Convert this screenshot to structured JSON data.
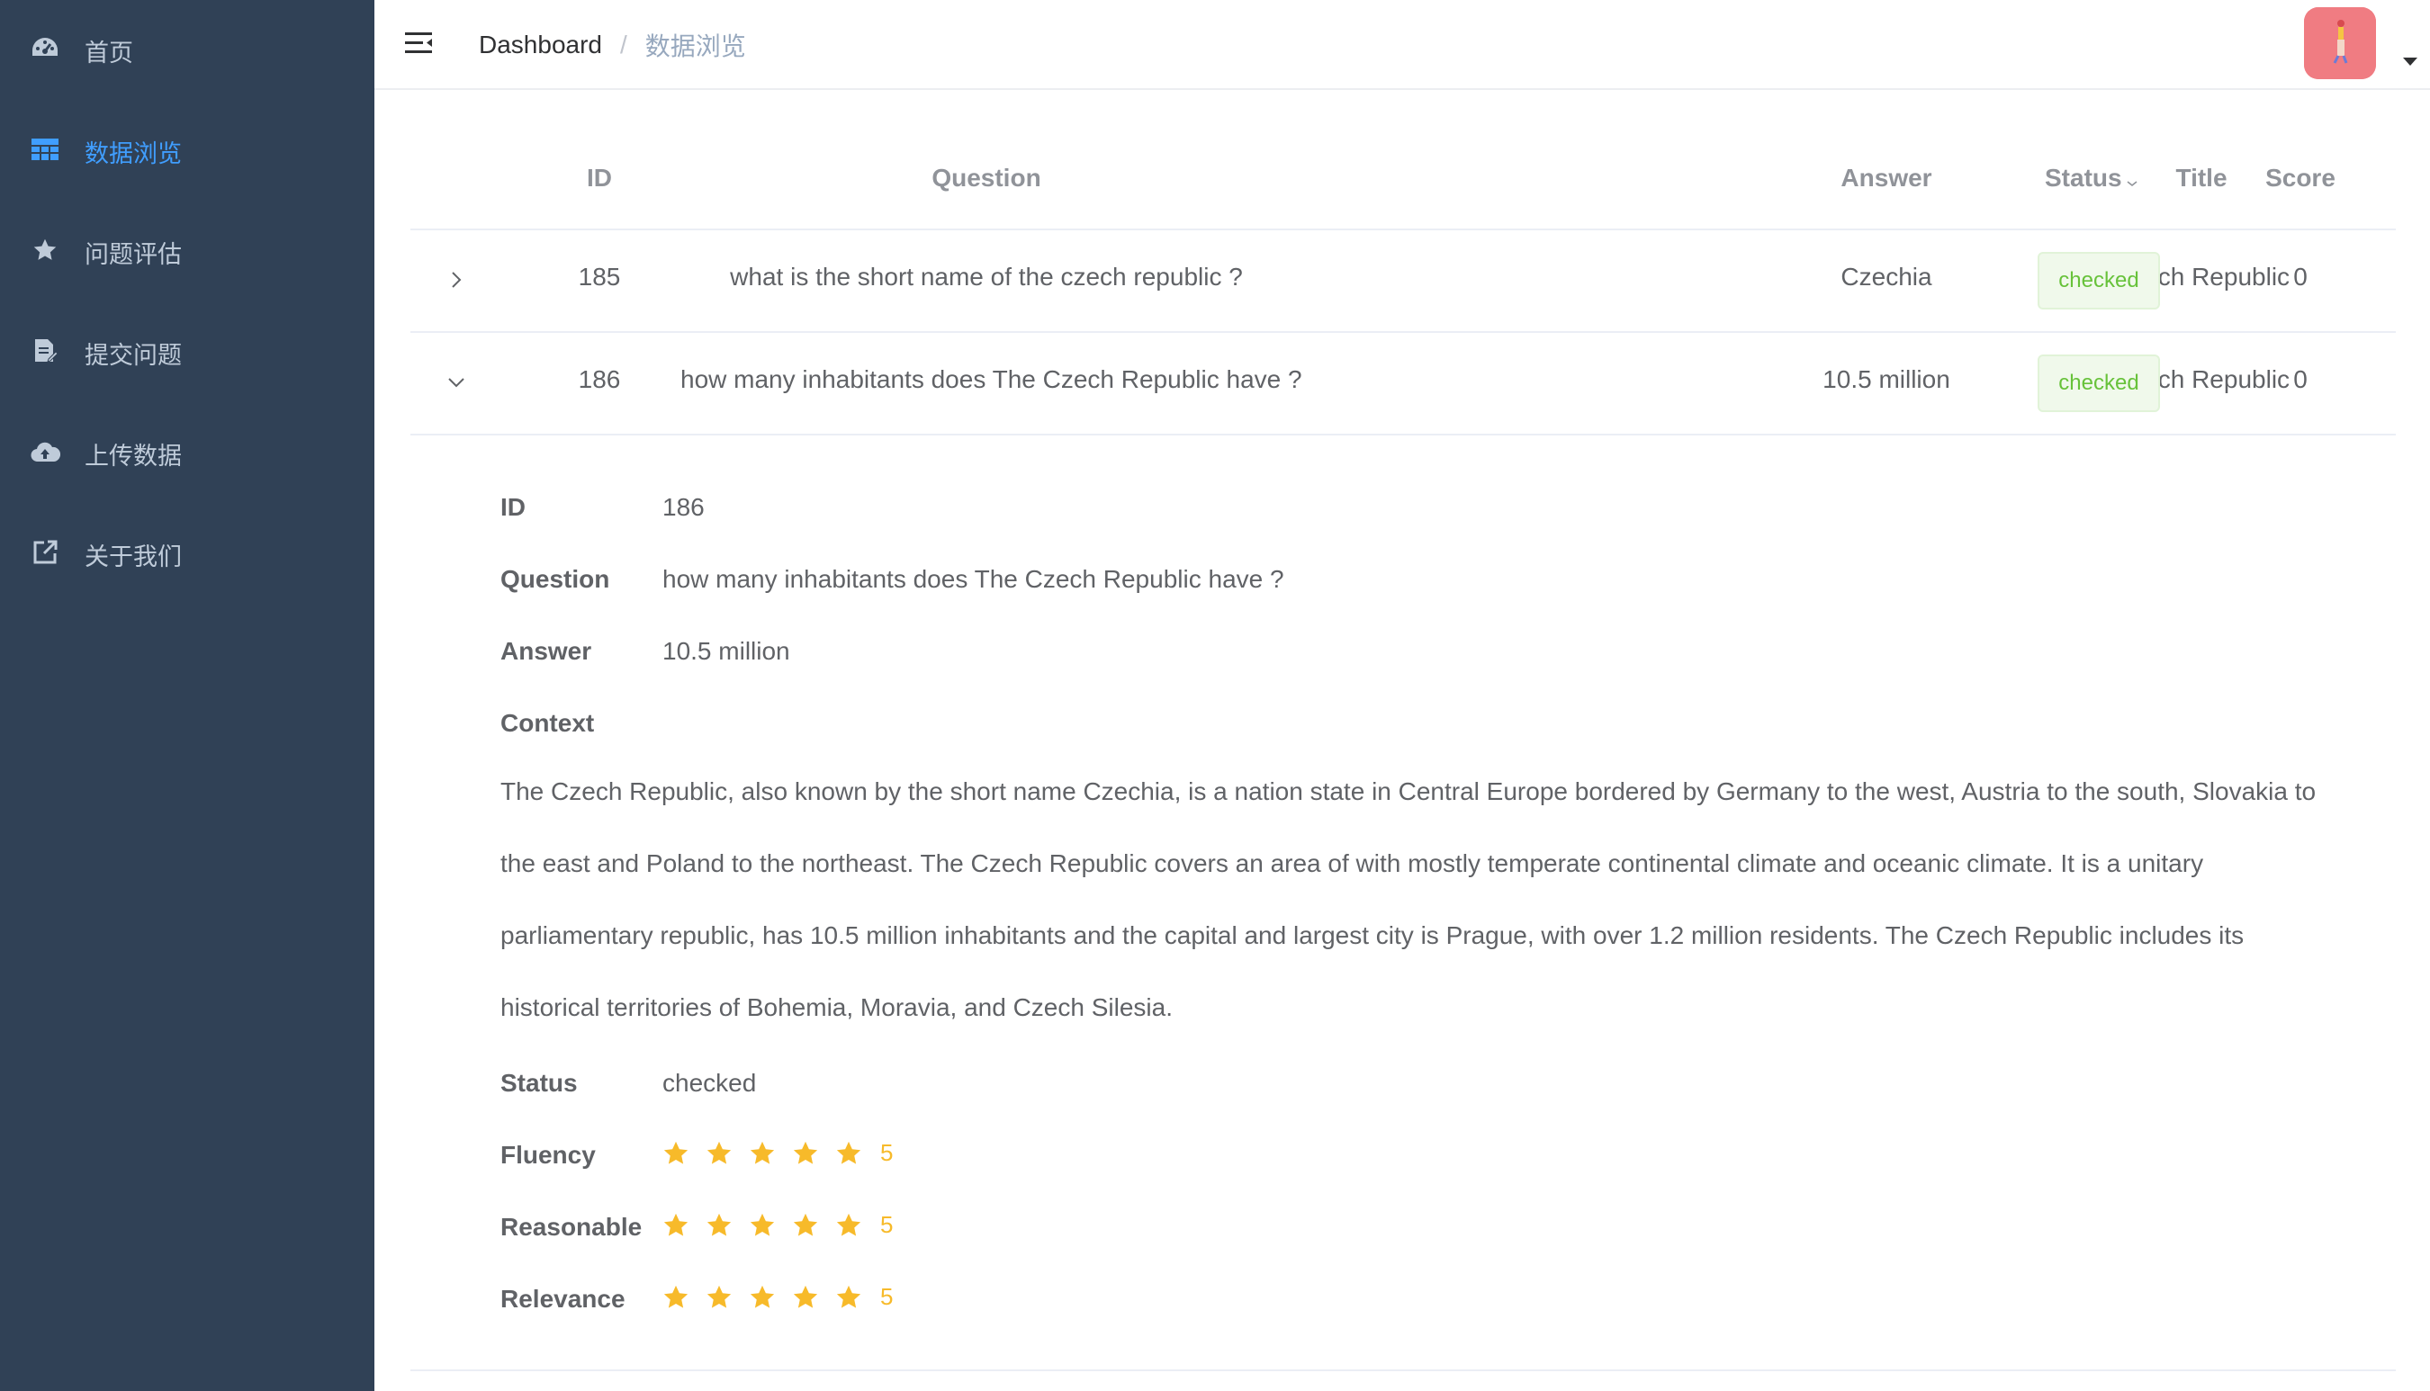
{
  "sidebar": {
    "items": [
      {
        "label": "首页",
        "icon": "dashboard-icon"
      },
      {
        "label": "数据浏览",
        "icon": "table-icon",
        "active": true
      },
      {
        "label": "问题评估",
        "icon": "star-icon"
      },
      {
        "label": "提交问题",
        "icon": "edit-doc-icon"
      },
      {
        "label": "上传数据",
        "icon": "cloud-upload-icon"
      },
      {
        "label": "关于我们",
        "icon": "external-link-icon"
      }
    ]
  },
  "navbar": {
    "breadcrumb": {
      "home": "Dashboard",
      "separator": "/",
      "current": "数据浏览"
    }
  },
  "table": {
    "headers": {
      "id": "ID",
      "question": "Question",
      "answer": "Answer",
      "title": "Title",
      "status": "Status",
      "score": "Score"
    },
    "rows": [
      {
        "id": "185",
        "question": "what is the short name of the czech republic ?",
        "answer": "Czechia",
        "title": "Czech Republic",
        "status": "checked",
        "score": "0",
        "expanded": false
      },
      {
        "id": "186",
        "question": "how many inhabitants does The Czech Republic have ?",
        "answer": "10.5 million",
        "title": "Czech Republic",
        "status": "checked",
        "score": "0",
        "expanded": true
      }
    ]
  },
  "detail": {
    "labels": {
      "id": "ID",
      "question": "Question",
      "answer": "Answer",
      "context": "Context",
      "status": "Status",
      "fluency": "Fluency",
      "reasonable": "Reasonable",
      "relevance": "Relevance"
    },
    "id": "186",
    "question": "how many inhabitants does The Czech Republic have ?",
    "answer": "10.5 million",
    "context": "The Czech Republic, also known by the short name Czechia, is a nation state in Central Europe bordered by Germany to the west, Austria to the south, Slovakia to the east and Poland to the northeast. The Czech Republic covers an area of with mostly temperate continental climate and oceanic climate. It is a unitary parliamentary republic, has 10.5 million inhabitants and the capital and largest city is Prague, with over 1.2 million residents. The Czech Republic includes its historical territories of Bohemia, Moravia, and Czech Silesia.",
    "status": "checked",
    "fluency": "5",
    "reasonable": "5",
    "relevance": "5"
  },
  "colors": {
    "sidebar_bg": "#304156",
    "active": "#409eff",
    "star": "#f7ba2a",
    "tag_text": "#67c23a",
    "avatar": "#f07c82"
  }
}
